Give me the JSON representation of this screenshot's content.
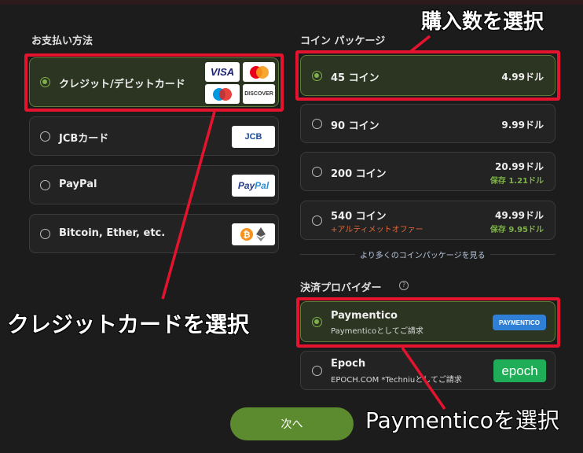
{
  "payment_methods": {
    "title": "お支払い方法",
    "options": [
      {
        "label": "クレジット/デビットカード",
        "selected": true
      },
      {
        "label": "JCBカード",
        "selected": false
      },
      {
        "label": "PayPal",
        "selected": false
      },
      {
        "label": "Bitcoin, Ether, etc.",
        "selected": false
      }
    ],
    "logos": {
      "visa": "VISA",
      "discover": "DISCOVER",
      "jcb": "JCB",
      "paypal_a": "Pay",
      "paypal_b": "Pal"
    }
  },
  "coin_packages": {
    "title": "コイン パッケージ",
    "options": [
      {
        "label": "45 コイン",
        "price": "4.99ドル",
        "selected": true
      },
      {
        "label": "90 コイン",
        "price": "9.99ドル",
        "selected": false
      },
      {
        "label": "200 コイン",
        "price": "20.99ドル",
        "save": "保存 1.21ドル",
        "selected": false
      },
      {
        "label": "540 コイン",
        "price": "49.99ドル",
        "save": "保存 9.95ドル",
        "offer": "+アルティメットオファー",
        "selected": false
      }
    ],
    "more_link": "より多くのコインパッケージを見る"
  },
  "providers": {
    "title": "決済プロバイダー",
    "options": [
      {
        "label": "Paymentico",
        "sub": "Paymenticoとしてご請求",
        "logo": "PAYMENTICO",
        "selected": true
      },
      {
        "label": "Epoch",
        "sub": "EPOCH.COM *Techniuとしてご請求",
        "logo": "epoch",
        "selected": false
      }
    ]
  },
  "next_button": "次へ",
  "callouts": {
    "quantity": "購入数を選択",
    "credit": "クレジットカードを選択",
    "paymentico": "Paymenticoを選択"
  },
  "colors": {
    "accent_green": "#7fb14a",
    "highlight_red": "#e5132e",
    "offer_orange": "#e0693a"
  }
}
